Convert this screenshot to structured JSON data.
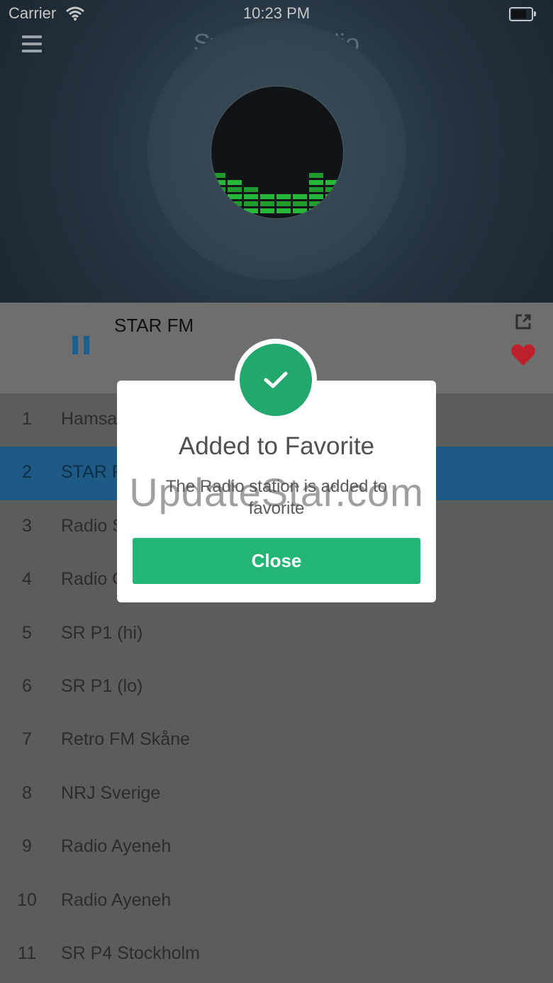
{
  "status_bar": {
    "carrier": "Carrier",
    "time": "10:23 PM"
  },
  "header": {
    "title": "Sweden Radio"
  },
  "player": {
    "now_playing": "STAR FM",
    "state": "playing"
  },
  "stations": [
    {
      "num": "1",
      "name": "Hamsa"
    },
    {
      "num": "2",
      "name": "STAR F"
    },
    {
      "num": "3",
      "name": "Radio S"
    },
    {
      "num": "4",
      "name": "Radio C"
    },
    {
      "num": "5",
      "name": "SR P1 (hi)"
    },
    {
      "num": "6",
      "name": "SR P1 (lo)"
    },
    {
      "num": "7",
      "name": "Retro FM Skåne"
    },
    {
      "num": "8",
      "name": "NRJ Sverige"
    },
    {
      "num": "9",
      "name": "Radio Ayeneh"
    },
    {
      "num": "10",
      "name": "Radio Ayeneh"
    },
    {
      "num": "11",
      "name": "SR P4 Stockholm"
    }
  ],
  "alert": {
    "title": "Added to Favorite",
    "message": "The Radio station is added to favorite",
    "close_label": "Close"
  },
  "watermark": "UpdateStar.com",
  "colors": {
    "accent_green": "#22b573",
    "selected_row": "#1d5a86",
    "heart": "#c0202c",
    "pause": "#1b5f8f"
  }
}
